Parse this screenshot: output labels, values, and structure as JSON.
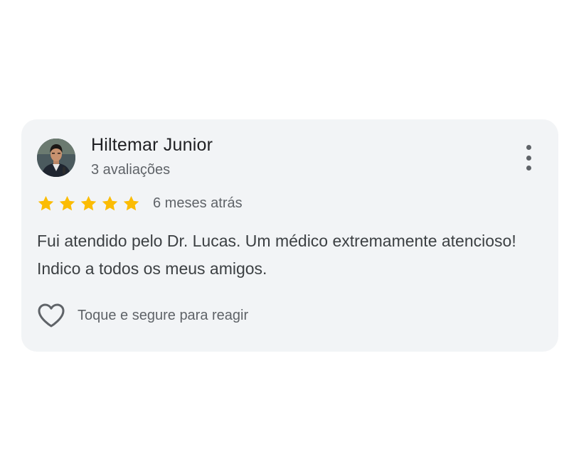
{
  "review": {
    "reviewer_name": "Hiltemar Junior",
    "review_count": "3 avaliações",
    "rating": 5,
    "rating_max": 5,
    "date": "6 meses atrás",
    "text": "Fui atendido pelo Dr. Lucas. Um médico extremamente atencioso! Indico a todos os meus amigos.",
    "react_label": "Toque e segure para reagir"
  },
  "icons": {
    "avatar": "user-photo-avatar",
    "more": "more-vert-icon",
    "star": "star-icon",
    "heart": "heart-outline-icon"
  },
  "colors": {
    "card_background": "#f2f4f6",
    "star": "#fbbc04",
    "primary_text": "#202124",
    "secondary_text": "#5f6368",
    "body_text": "#3c4043"
  }
}
